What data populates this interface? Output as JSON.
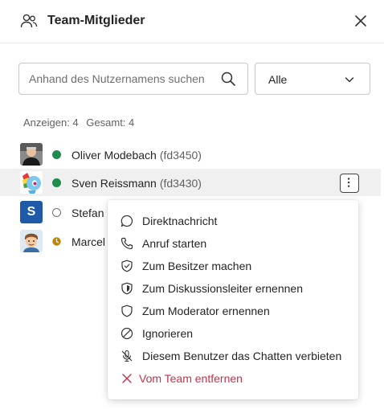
{
  "header": {
    "title": "Team-Mitglieder"
  },
  "search": {
    "placeholder": "Anhand des Nutzernamens suchen",
    "value": ""
  },
  "filter": {
    "value": "Alle"
  },
  "counts": {
    "shown": "Anzeigen: 4",
    "total": "Gesamt: 4"
  },
  "members": [
    {
      "name": "Oliver Modebach",
      "uid": "(fd3450)",
      "status": "online"
    },
    {
      "name": "Sven Reissmann",
      "uid": "(fd3430)",
      "status": "online"
    },
    {
      "name": "Stefan F",
      "uid": "",
      "status": "offline",
      "avatar_letter": "S"
    },
    {
      "name": "Marcel",
      "uid": "",
      "status": "away"
    }
  ],
  "menu": {
    "items": [
      {
        "label": "Direktnachricht",
        "icon": "chat-icon"
      },
      {
        "label": "Anruf starten",
        "icon": "phone-icon"
      },
      {
        "label": "Zum Besitzer machen",
        "icon": "shield-check-icon"
      },
      {
        "label": "Zum Diskussionsleiter ernennen",
        "icon": "shield-half-icon"
      },
      {
        "label": "Zum Moderator ernennen",
        "icon": "shield-icon"
      },
      {
        "label": "Ignorieren",
        "icon": "block-icon"
      },
      {
        "label": "Diesem Benutzer das Chatten verbieten",
        "icon": "mic-off-icon"
      },
      {
        "label": "Vom Team entfernen",
        "icon": "remove-icon",
        "danger": true
      }
    ]
  },
  "colors": {
    "online": "#1e8b4f",
    "away": "#b8860b",
    "offline": "#888888",
    "danger": "#c4314b",
    "avatar_blue": "#1e5aa8"
  }
}
